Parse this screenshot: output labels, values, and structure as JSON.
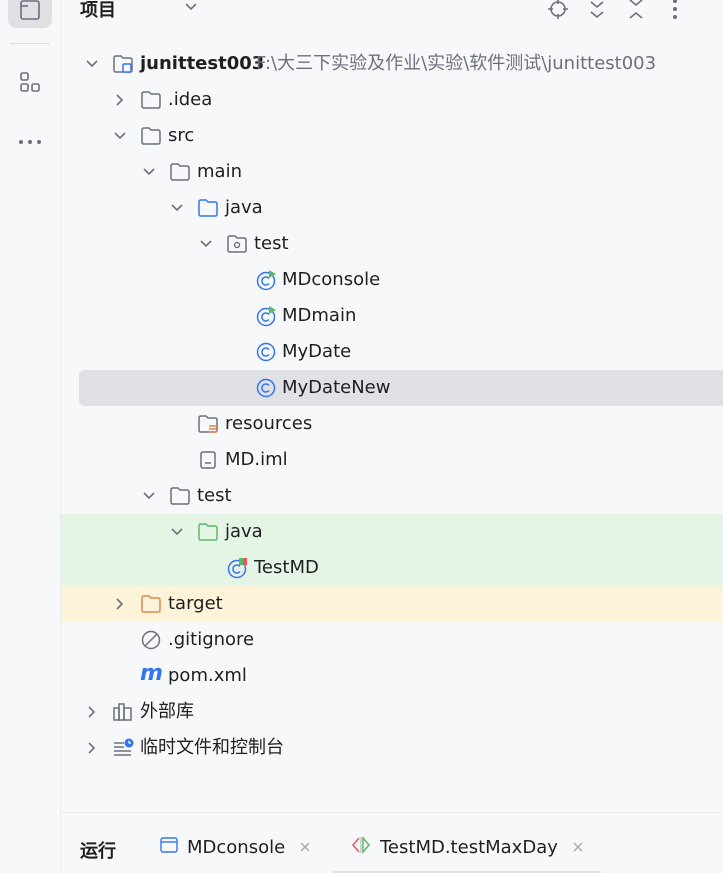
{
  "header": {
    "title": "项目"
  },
  "tree": {
    "project_name": "junittest003",
    "project_path": "F:\\大三下实验及作业\\实验\\软件测试\\junittest003",
    "items": [
      {
        "label": ".idea"
      },
      {
        "label": "src"
      },
      {
        "label": "main"
      },
      {
        "label": "java"
      },
      {
        "label": "test"
      },
      {
        "label": "MDconsole"
      },
      {
        "label": "MDmain"
      },
      {
        "label": "MyDate"
      },
      {
        "label": "MyDateNew"
      },
      {
        "label": "resources"
      },
      {
        "label": "MD.iml"
      },
      {
        "label": "test"
      },
      {
        "label": "java"
      },
      {
        "label": "TestMD"
      },
      {
        "label": "target"
      },
      {
        "label": ".gitignore"
      },
      {
        "label": "pom.xml"
      },
      {
        "label": "外部库"
      },
      {
        "label": "临时文件和控制台"
      }
    ]
  },
  "bottom": {
    "run_label": "运行",
    "tabs": [
      {
        "label": "MDconsole"
      },
      {
        "label": "TestMD.testMaxDay"
      }
    ]
  },
  "colors": {
    "selected_row": "#dfe1e5",
    "test_source_row": "#e4f5e6",
    "excluded_row": "#fdf3d9",
    "folder_source_blue": "#3574f0",
    "folder_test_green": "#5fb865",
    "folder_excluded_orange": "#e08855"
  }
}
